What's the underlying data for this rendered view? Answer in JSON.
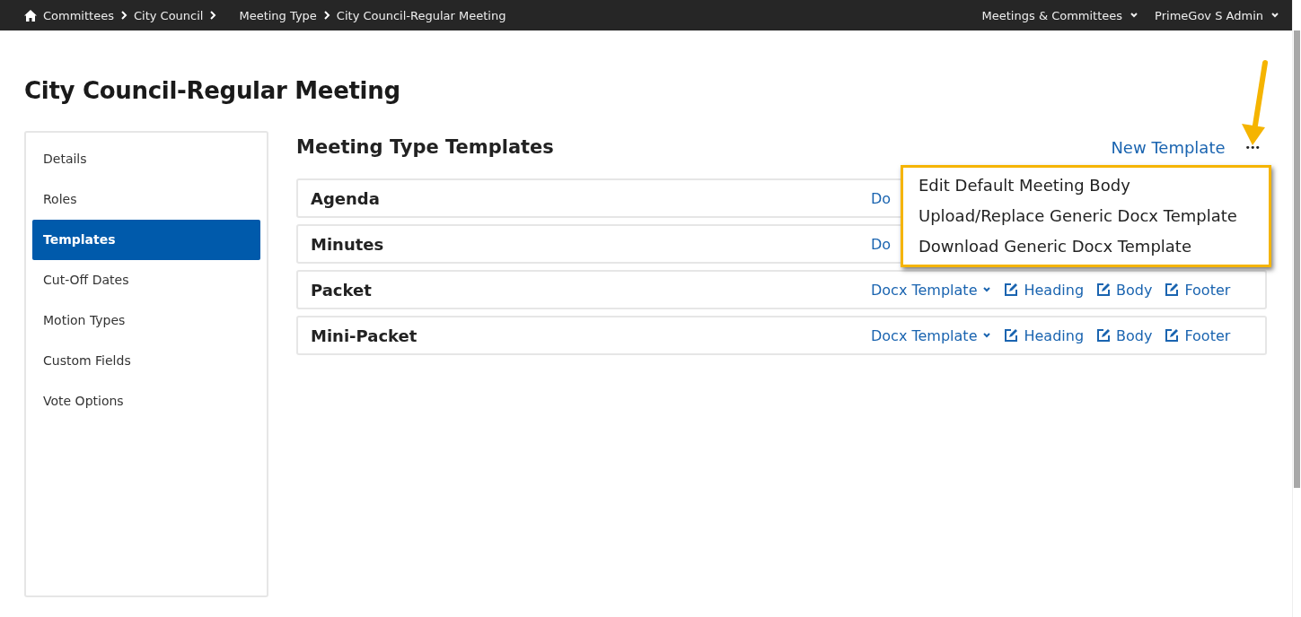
{
  "breadcrumbs": [
    {
      "label": "Committees"
    },
    {
      "label": "City Council"
    },
    {
      "label": "Meeting Type"
    },
    {
      "label": "City Council-Regular Meeting"
    }
  ],
  "top_menus": [
    {
      "label": "Meetings & Committees"
    },
    {
      "label": "PrimeGov S Admin"
    }
  ],
  "page_title": "City Council-Regular Meeting",
  "sidebar": {
    "items": [
      {
        "label": "Details",
        "selected": false
      },
      {
        "label": "Roles",
        "selected": false
      },
      {
        "label": "Templates",
        "selected": true
      },
      {
        "label": "Cut-Off Dates",
        "selected": false
      },
      {
        "label": "Motion Types",
        "selected": false
      },
      {
        "label": "Custom Fields",
        "selected": false
      },
      {
        "label": "Vote Options",
        "selected": false
      }
    ]
  },
  "section_title": "Meeting Type Templates",
  "new_template_link": "New Template",
  "more_button": "•••",
  "templates": [
    {
      "name": "Agenda",
      "actions": [
        {
          "kind": "dropdown",
          "label": "Do"
        }
      ]
    },
    {
      "name": "Minutes",
      "actions": [
        {
          "kind": "dropdown",
          "label": "Do"
        }
      ]
    },
    {
      "name": "Packet",
      "actions": [
        {
          "kind": "dropdown",
          "label": "Docx Template"
        },
        {
          "kind": "edit",
          "label": "Heading"
        },
        {
          "kind": "edit",
          "label": "Body"
        },
        {
          "kind": "edit",
          "label": "Footer"
        }
      ]
    },
    {
      "name": "Mini-Packet",
      "actions": [
        {
          "kind": "dropdown",
          "label": "Docx Template"
        },
        {
          "kind": "edit",
          "label": "Heading"
        },
        {
          "kind": "edit",
          "label": "Body"
        },
        {
          "kind": "edit",
          "label": "Footer"
        }
      ]
    }
  ],
  "more_menu": {
    "items": [
      {
        "label": "Edit Default Meeting Body"
      },
      {
        "label": "Upload/Replace Generic Docx Template"
      },
      {
        "label": "Download Generic Docx Template"
      }
    ]
  }
}
